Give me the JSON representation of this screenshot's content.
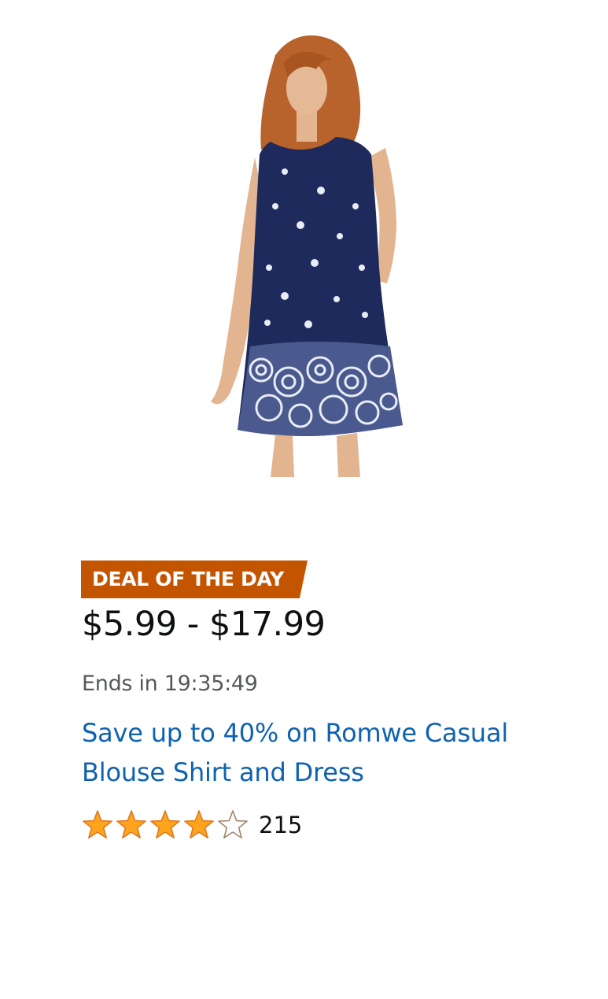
{
  "product": {
    "image_alt": "Navy sleeveless dress with white floral and circular border print",
    "image_colors": {
      "dress": "#1f2a5c",
      "print": "#e8ecf4",
      "hair": "#b9632c",
      "skin": "#e2b48f"
    }
  },
  "deal": {
    "badge": "DEAL OF THE DAY",
    "badge_color": "#c45500",
    "price": "$5.99 - $17.99",
    "ends": "Ends in 19:35:49",
    "title": "Save up to 40% on Romwe Casual Blouse Shirt and Dress",
    "link_color": "#0f62b0"
  },
  "rating": {
    "stars": 4,
    "max_stars": 5,
    "count": "215",
    "star_color": "#ffa41c",
    "star_outline": "#de7921"
  }
}
